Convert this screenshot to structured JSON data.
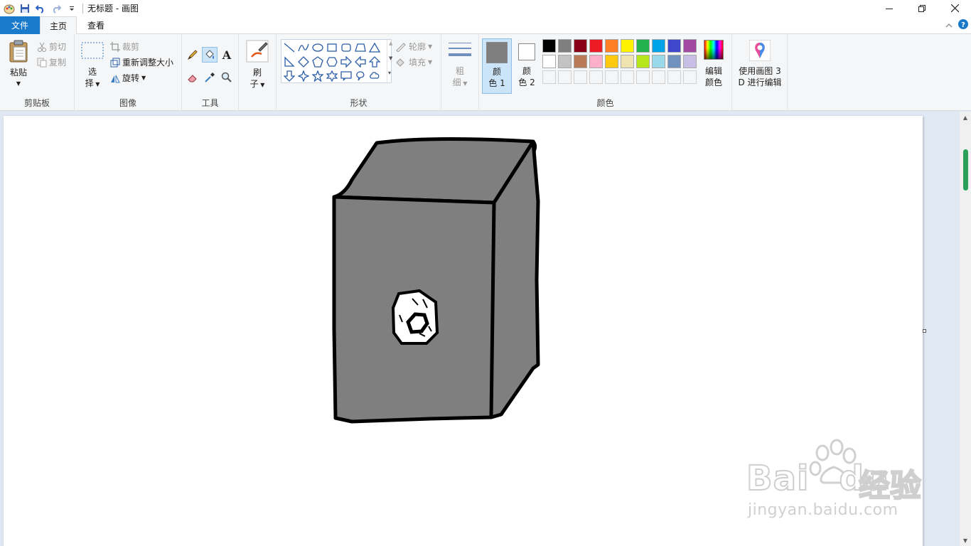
{
  "window": {
    "title": "无标题 - 画图"
  },
  "tabs": {
    "file": "文件",
    "home": "主页",
    "view": "查看"
  },
  "clipboard": {
    "paste": "粘贴",
    "cut": "剪切",
    "copy": "复制",
    "label": "剪贴板"
  },
  "image": {
    "select_line1": "选",
    "select_line2": "择",
    "crop": "裁剪",
    "resize": "重新调整大小",
    "rotate": "旋转",
    "label": "图像"
  },
  "tools": {
    "label": "工具",
    "text_glyph": "A"
  },
  "brushes": {
    "line1": "刷",
    "line2": "子"
  },
  "shapes": {
    "outline": "轮廓",
    "fill": "填充",
    "label": "形状"
  },
  "size": {
    "line1": "粗",
    "line2": "细"
  },
  "colors": {
    "color1_line1": "颜",
    "color1_line2": "色 1",
    "color2_line1": "颜",
    "color2_line2": "色 2",
    "color1_value": "#7f7f7f",
    "color2_value": "#ffffff",
    "edit_line1": "编辑",
    "edit_line2": "颜色",
    "label": "颜色",
    "palette_row1": [
      "#000000",
      "#7f7f7f",
      "#880015",
      "#ed1c24",
      "#ff7f27",
      "#fff200",
      "#22b14c",
      "#00a2e8",
      "#3f48cc",
      "#a349a4"
    ],
    "palette_row2": [
      "#ffffff",
      "#c3c3c3",
      "#b97a57",
      "#ffaec9",
      "#ffc90e",
      "#efe4b0",
      "#b5e61d",
      "#99d9ea",
      "#7092be",
      "#c8bfe7"
    ]
  },
  "paint3d": {
    "line1": "使用画图 3",
    "line2": "D 进行编辑"
  },
  "watermark": {
    "brand_latin": "Bai",
    "brand_latin2": "du",
    "brand_cn": "经验",
    "url": "jingyan.baidu.com"
  }
}
